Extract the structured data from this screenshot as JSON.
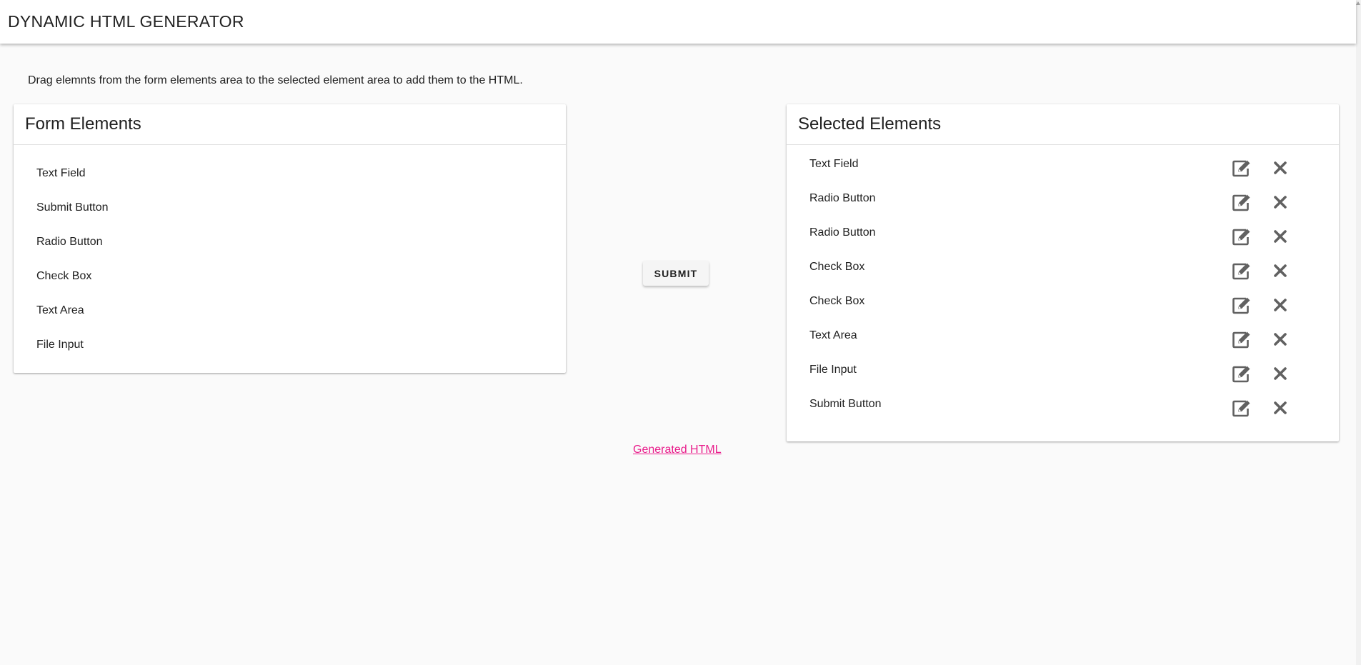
{
  "app": {
    "title": "DYNAMIC HTML GENERATOR"
  },
  "instructions": "Drag elemnts from the form elements area to the selected element area to add them to the HTML.",
  "form_elements": {
    "header": "Form Elements",
    "items": [
      "Text Field",
      "Submit Button",
      "Radio Button",
      "Check Box",
      "Text Area",
      "File Input"
    ]
  },
  "selected_elements": {
    "header": "Selected Elements",
    "items": [
      "Text Field",
      "Radio Button",
      "Radio Button",
      "Check Box",
      "Check Box",
      "Text Area",
      "File Input",
      "Submit Button"
    ],
    "icons": {
      "edit": "edit-icon",
      "remove": "close-icon"
    }
  },
  "submit_label": "SUBMIT",
  "generated_link": "Generated HTML",
  "colors": {
    "link": "#e91e8c",
    "icon": "#616161",
    "background": "#fafafa"
  }
}
